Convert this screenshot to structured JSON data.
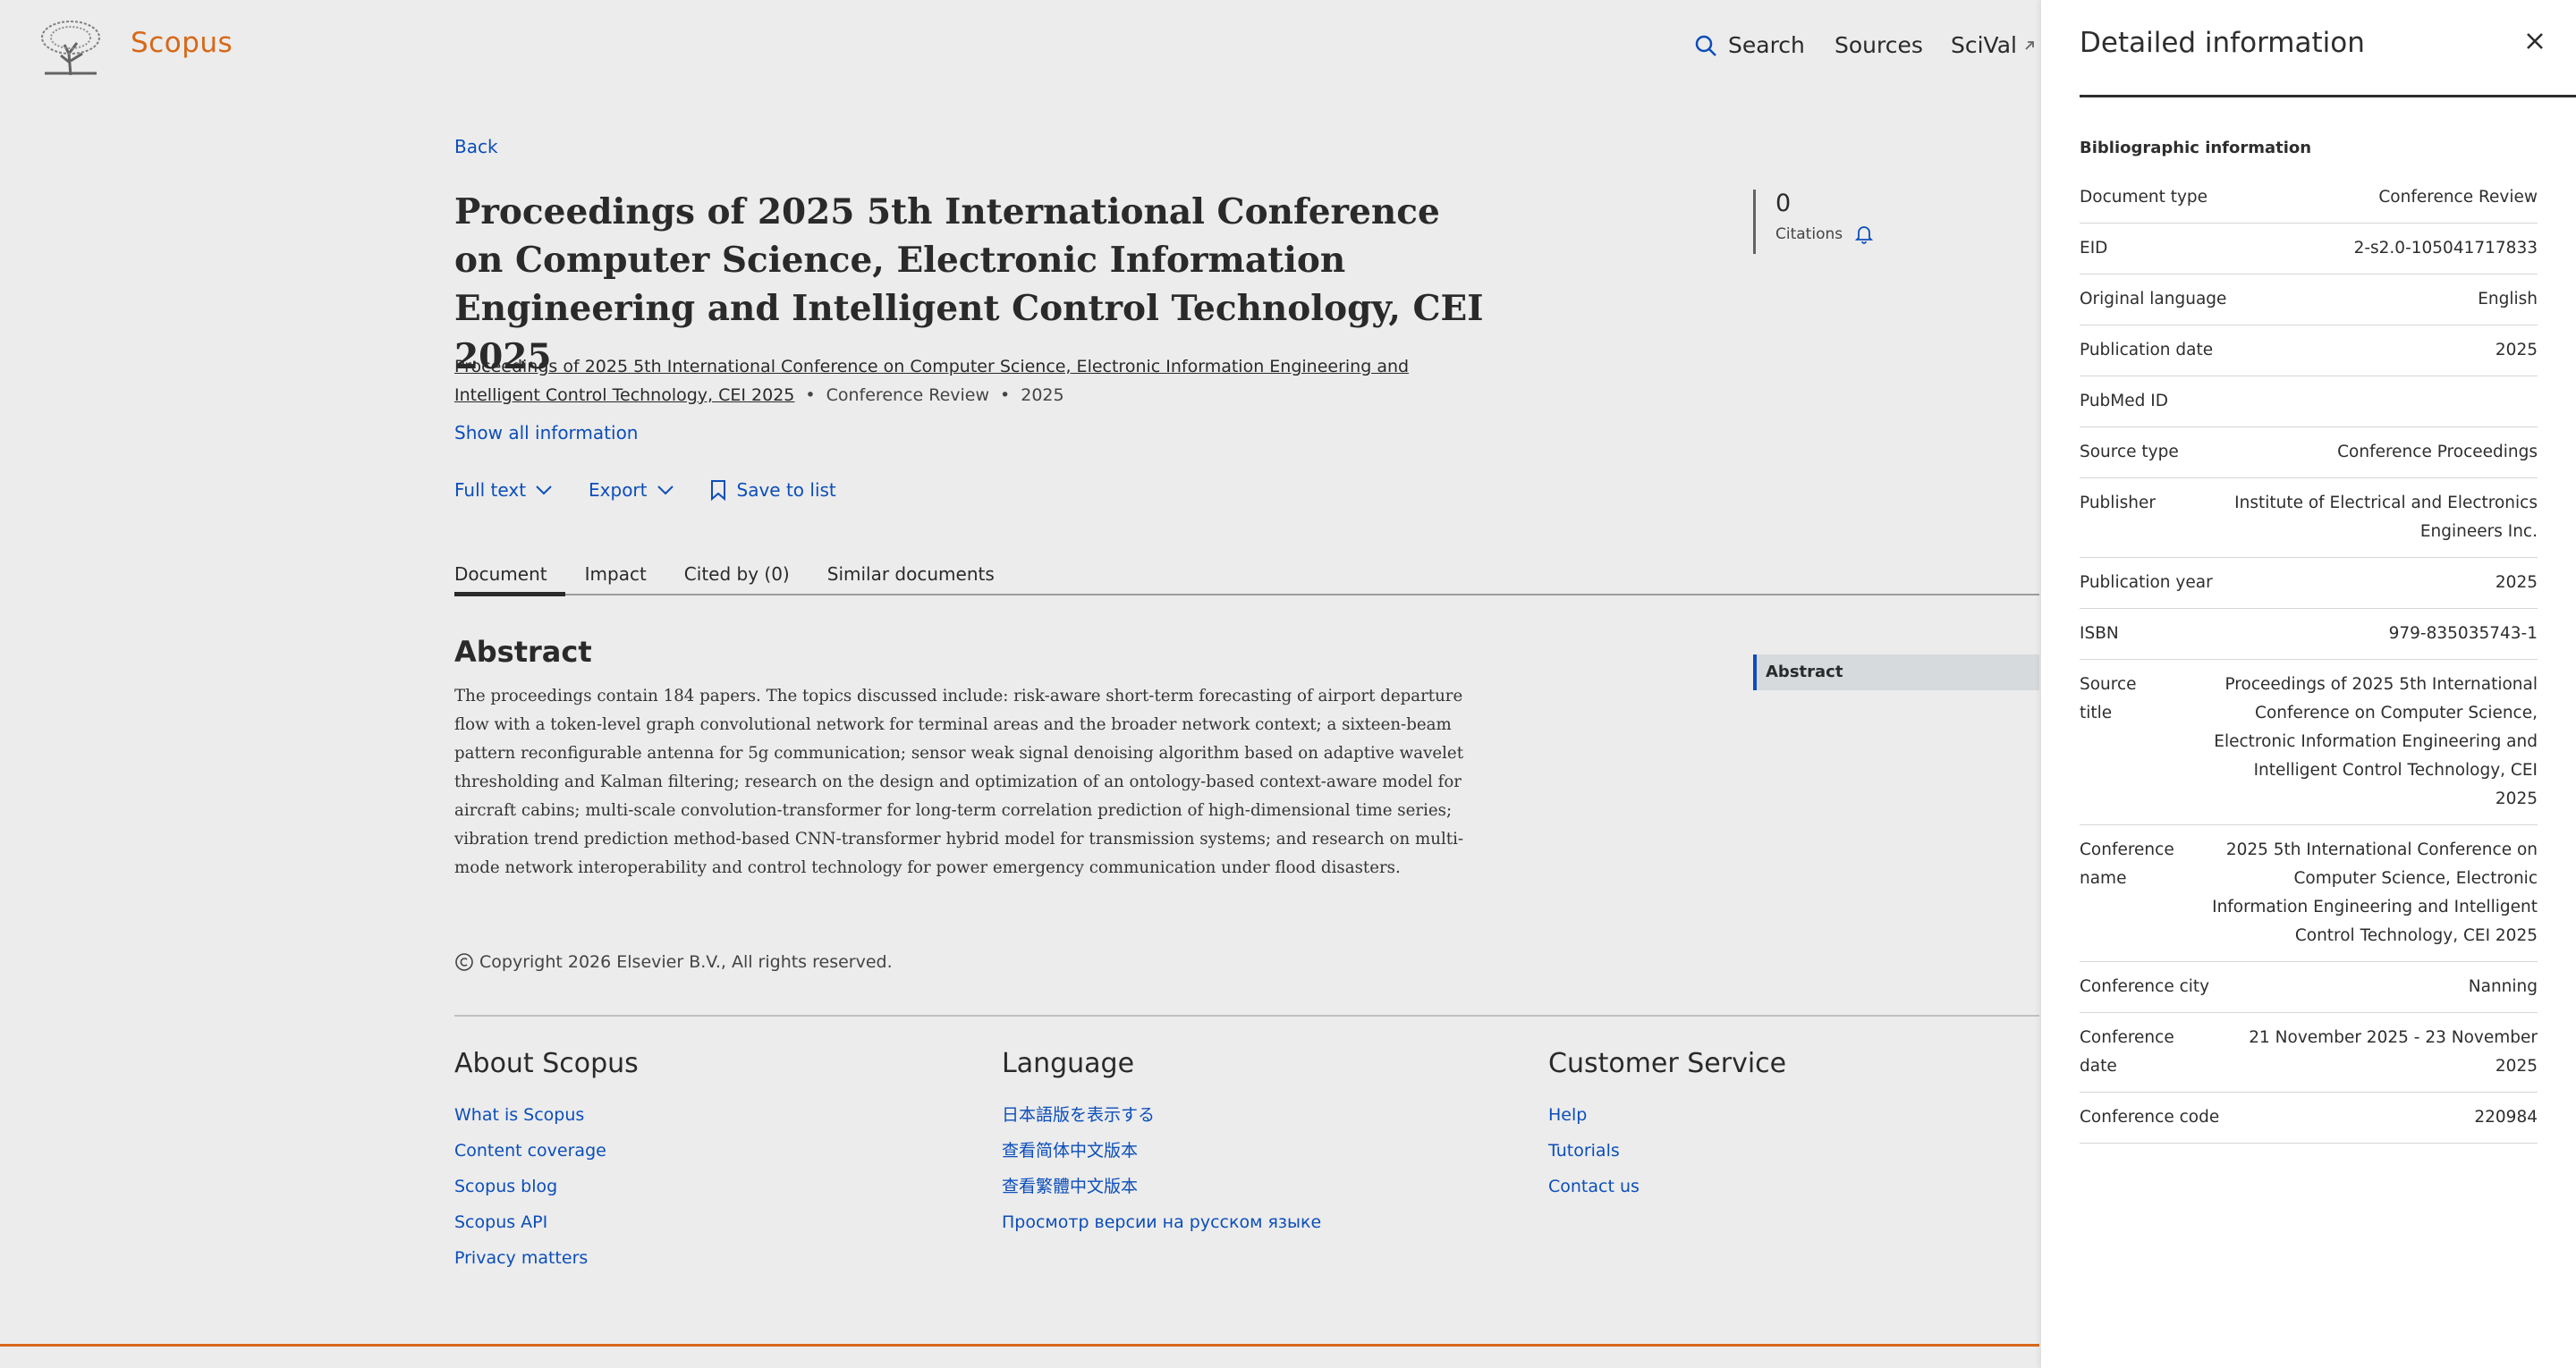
{
  "header": {
    "brand": "Scopus",
    "nav": {
      "search": "Search",
      "sources": "Sources",
      "scival": "SciVal"
    }
  },
  "back_label": "Back",
  "document": {
    "title": "Proceedings of 2025 5th International Conference on Computer Science, Electronic Information Engineering and Intelligent Control Technology, CEI 2025",
    "source_title": "Proceedings of 2025 5th International Conference on Computer Science, Electronic Information Engineering and Intelligent Control Technology, CEI 2025",
    "doc_type": "Conference Review",
    "year": "2025",
    "show_all": "Show all information",
    "actions": {
      "full_text": "Full text",
      "export": "Export",
      "save": "Save to list"
    },
    "citations": {
      "count": "0",
      "label": "Citations"
    }
  },
  "tabs": [
    "Document",
    "Impact",
    "Cited by (0)",
    "Similar documents"
  ],
  "abstract": {
    "heading": "Abstract",
    "text": "The proceedings contain 184 papers. The topics discussed include: risk-aware short-term forecasting of airport departure flow with a token-level graph convolutional network for terminal areas and the broader network context; a sixteen-beam pattern reconfigurable antenna for 5g communication; sensor weak signal denoising algorithm based on adaptive wavelet thresholding and Kalman filtering; research on the design and optimization of an ontology-based context-aware model for aircraft cabins; multi-scale convolution-transformer for long-term correlation prediction of high-dimensional time series; vibration trend prediction method-based CNN-transformer hybrid model for transmission systems; and research on multi-mode network interoperability and control technology for power emergency communication under flood disasters.",
    "toc_label": "Abstract"
  },
  "footer": {
    "copyright": "Copyright 2026 Elsevier B.V., All rights reserved.",
    "about": {
      "heading": "About Scopus",
      "links": [
        "What is Scopus",
        "Content coverage",
        "Scopus blog",
        "Scopus API",
        "Privacy matters"
      ]
    },
    "language": {
      "heading": "Language",
      "links": [
        "日本語版を表示する",
        "查看简体中文版本",
        "查看繁體中文版本",
        "Просмотр версии на русском языке"
      ]
    },
    "service": {
      "heading": "Customer Service",
      "links": [
        "Help",
        "Tutorials",
        "Contact us"
      ]
    }
  },
  "panel": {
    "title": "Detailed information",
    "subheading": "Bibliographic information",
    "rows": [
      {
        "k": "Document type",
        "v": "Conference Review"
      },
      {
        "k": "EID",
        "v": "2-s2.0-105041717833"
      },
      {
        "k": "Original language",
        "v": "English"
      },
      {
        "k": "Publication date",
        "v": "2025"
      },
      {
        "k": "PubMed ID",
        "v": ""
      },
      {
        "k": "Source type",
        "v": "Conference Proceedings"
      },
      {
        "k": "Publisher",
        "v": "Institute of Electrical and Electronics Engineers Inc."
      },
      {
        "k": "Publication year",
        "v": "2025"
      },
      {
        "k": "ISBN",
        "v": "979-835035743-1"
      },
      {
        "k": "Source title",
        "v": "Proceedings of 2025 5th International Conference on Computer Science, Electronic Information Engineering and Intelligent Control Technology, CEI 2025"
      },
      {
        "k": "Conference name",
        "v": "2025 5th International Conference on Computer Science, Electronic Information Engineering and Intelligent Control Technology, CEI 2025"
      },
      {
        "k": "Conference city",
        "v": "Nanning"
      },
      {
        "k": "Conference date",
        "v": "21 November 2025 - 23 November 2025"
      },
      {
        "k": "Conference code",
        "v": "220984"
      }
    ]
  },
  "colors": {
    "brand": "#e9711c",
    "link": "#0d55c9",
    "text": "#2e2e2e"
  }
}
